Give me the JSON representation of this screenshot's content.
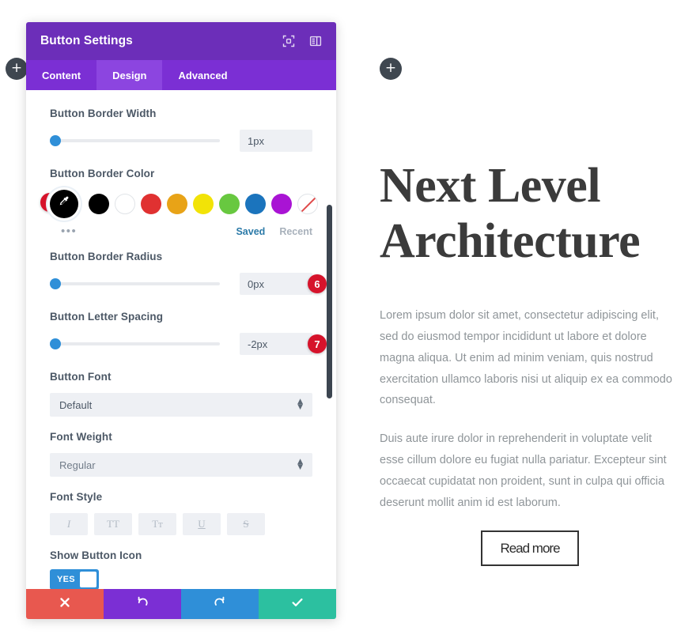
{
  "canvas": {
    "add_left_label": "+",
    "add_right_label": "+"
  },
  "modal": {
    "title": "Button Settings",
    "header_icons": [
      {
        "name": "fullscreen-icon"
      },
      {
        "name": "layout-panel-icon"
      }
    ],
    "tabs": [
      {
        "label": "Content",
        "active": false
      },
      {
        "label": "Design",
        "active": true
      },
      {
        "label": "Advanced",
        "active": false
      }
    ],
    "fields": {
      "border_width": {
        "label": "Button Border Width",
        "value": "1px",
        "slider_pct": 0
      },
      "border_color": {
        "label": "Button Border Color",
        "badge": "5",
        "active_swatch": "#000000",
        "active_icon": "eyedropper-icon",
        "swatches": [
          "#000000",
          "#ffffff",
          "#e03131",
          "#e8a317",
          "#f2e307",
          "#68c840",
          "#1b74bd",
          "#a914d4"
        ],
        "none_swatch_label": "no-color",
        "more_dots": "•••",
        "saved_label": "Saved",
        "recent_label": "Recent"
      },
      "border_radius": {
        "label": "Button Border Radius",
        "value": "0px",
        "badge": "6",
        "slider_pct": 0
      },
      "letter_spacing": {
        "label": "Button Letter Spacing",
        "value": "-2px",
        "badge": "7",
        "slider_pct": 0
      },
      "button_font": {
        "label": "Button Font",
        "value": "Default"
      },
      "font_weight": {
        "label": "Font Weight",
        "value": "Regular"
      },
      "font_style": {
        "label": "Font Style",
        "buttons": [
          {
            "name": "italic-icon",
            "glyph": "I"
          },
          {
            "name": "uppercase-icon",
            "glyph": "TT"
          },
          {
            "name": "small-caps-icon",
            "glyph": "Tᴛ"
          },
          {
            "name": "underline-icon",
            "glyph": "U"
          },
          {
            "name": "strikethrough-icon",
            "glyph": "S"
          }
        ]
      },
      "show_button_icon": {
        "label": "Show Button Icon",
        "toggle_value": "YES"
      }
    },
    "actions": [
      {
        "name": "cancel-button",
        "icon": "cross-icon",
        "glyph": "✖",
        "color": "#e8584f"
      },
      {
        "name": "undo-button",
        "icon": "undo-icon",
        "glyph": "↺",
        "color": "#7b2fd4"
      },
      {
        "name": "redo-button",
        "icon": "redo-icon",
        "glyph": "↻",
        "color": "#2f8fd8"
      },
      {
        "name": "save-button",
        "icon": "check-icon",
        "glyph": "✔",
        "color": "#2cc0a0"
      }
    ]
  },
  "page": {
    "title": "Next Level Architecture",
    "paragraph_1": "Lorem ipsum dolor sit amet, consectetur adipiscing elit, sed do eiusmod tempor incididunt ut labore et dolore magna aliqua. Ut enim ad minim veniam, quis nostrud exercitation ullamco laboris nisi ut aliquip ex ea commodo consequat.",
    "paragraph_2": "Duis aute irure dolor in reprehenderit in voluptate velit esse cillum dolore eu fugiat nulla pariatur. Excepteur sint occaecat cupidatat non proident, sunt in culpa qui officia deserunt mollit anim id est laborum.",
    "cta_label": "Read more"
  },
  "colors": {
    "modal_header": "#6c2eb9",
    "tabs_bar": "#7b2fd4",
    "tab_active": "#8c45e0",
    "accent_blue": "#2f8fd8",
    "badge_red": "#d6132b"
  }
}
